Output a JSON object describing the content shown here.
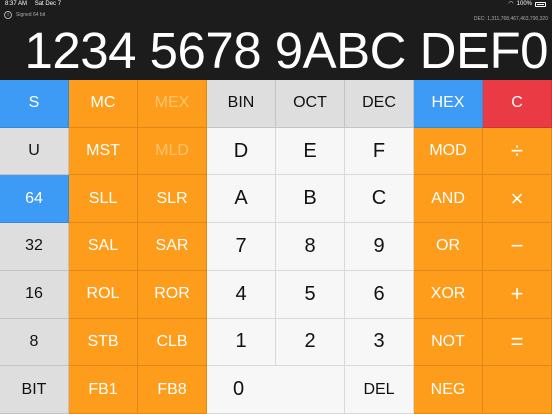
{
  "status_bar": {
    "time": "8:37 AM",
    "date": "Sat Dec 7",
    "battery": "100%"
  },
  "display": {
    "signed_label": "Signed 64 bit",
    "decimal_line": "DEC: 1,311,768,467,463,790,320",
    "value": "1234 5678 9ABC DEF0"
  },
  "colors": {
    "blue": "#3d9bf6",
    "orange": "#fd9d1b",
    "red": "#ea3b45",
    "grey": "#dedede",
    "light": "#f7f7f7",
    "display_bg": "#1c1c1c"
  },
  "keys": {
    "r1": [
      "S",
      "MC",
      "MEX",
      "BIN",
      "OCT",
      "DEC",
      "HEX",
      "C"
    ],
    "r2": [
      "U",
      "MST",
      "MLD",
      "D",
      "E",
      "F",
      "MOD",
      "÷"
    ],
    "r3": [
      "64",
      "SLL",
      "SLR",
      "A",
      "B",
      "C",
      "AND",
      "×"
    ],
    "r4": [
      "32",
      "SAL",
      "SAR",
      "7",
      "8",
      "9",
      "OR",
      "−"
    ],
    "r5": [
      "16",
      "ROL",
      "ROR",
      "4",
      "5",
      "6",
      "XOR",
      "+"
    ],
    "r6": [
      "8",
      "STB",
      "CLB",
      "1",
      "2",
      "3",
      "NOT",
      "="
    ],
    "r7": [
      "BIT",
      "FB1",
      "FB8",
      "0",
      "DEL",
      "NEG"
    ]
  }
}
